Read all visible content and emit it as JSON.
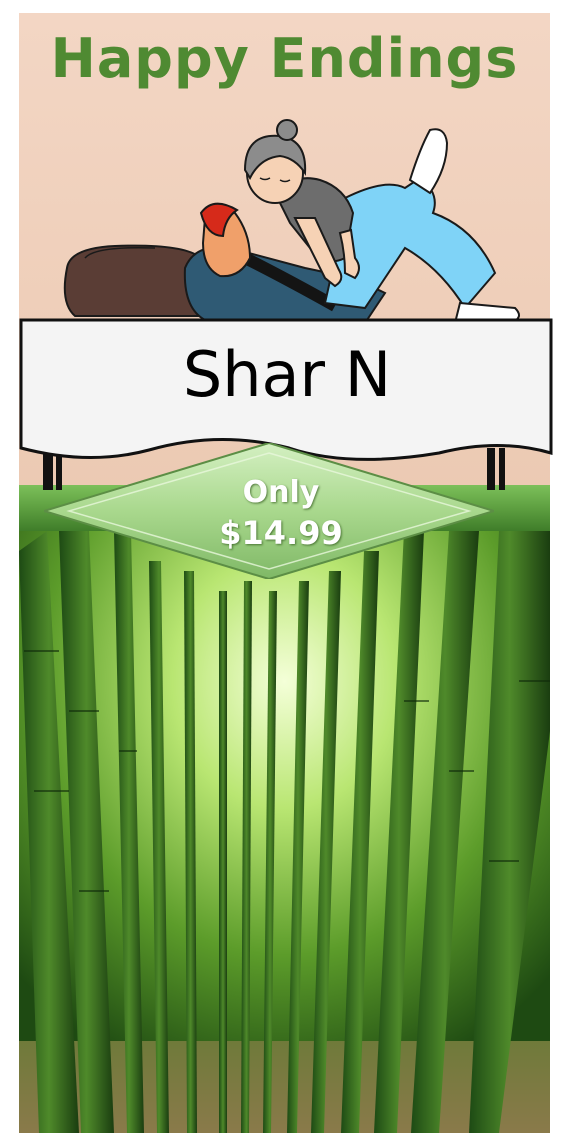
{
  "poster": {
    "title": "Happy Endings",
    "sign_text": "Shar N",
    "price_prefix": "Only",
    "price": "$14.99"
  },
  "colors": {
    "title": "#4f8a32",
    "background_top": "#f3d6c4",
    "banner_green": "#5b9c3e",
    "diamond_green": "#a9d88d",
    "price_text": "#ffffff"
  },
  "icons": [
    "massage-illustration",
    "bamboo-forest-photo"
  ]
}
